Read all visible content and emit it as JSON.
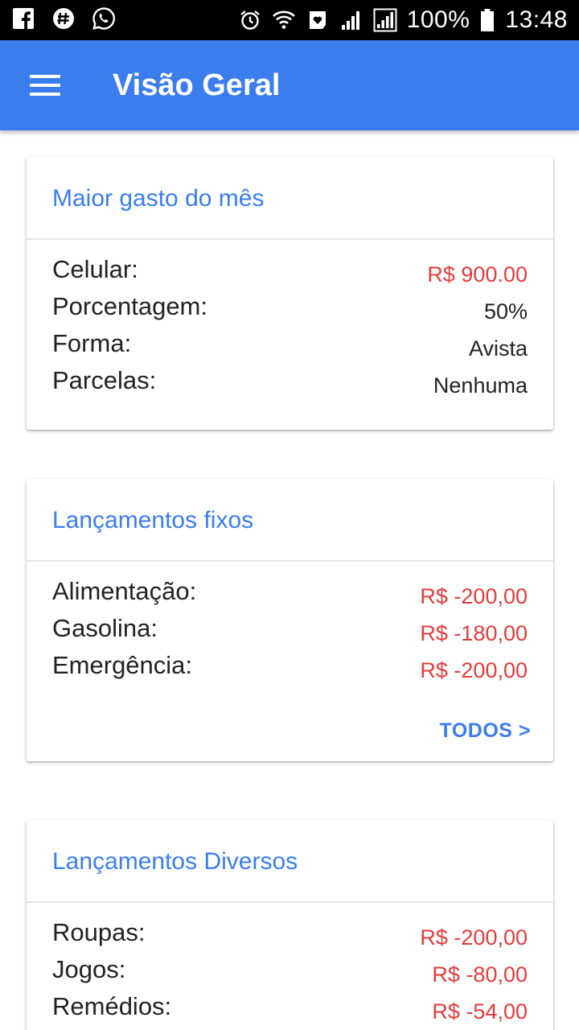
{
  "status_bar": {
    "left_icons": [
      "facebook-icon",
      "hashtag-app-icon",
      "whatsapp-icon"
    ],
    "right_icons": [
      "alarm-icon",
      "wifi-icon",
      "heart-notification-icon",
      "signal-icon",
      "signal-r-icon"
    ],
    "battery_text": "100%",
    "battery_icon": "battery-icon",
    "time": "13:48"
  },
  "app_bar": {
    "menu_icon": "hamburger-menu-icon",
    "title": "Visão Geral",
    "color": "#3b7ded"
  },
  "colors": {
    "accent": "#3b7ded",
    "negative": "#e63b3b",
    "text": "#222222"
  },
  "cards": [
    {
      "title": "Maior gasto do mês",
      "rows": [
        {
          "label": "Celular:",
          "value": "R$ 900.00",
          "highlight": true
        },
        {
          "label": "Porcentagem:",
          "value": "50%",
          "highlight": false
        },
        {
          "label": "Forma:",
          "value": "Avista",
          "highlight": false
        },
        {
          "label": "Parcelas:",
          "value": "Nenhuma",
          "highlight": false
        }
      ]
    },
    {
      "title": "Lançamentos fixos",
      "rows": [
        {
          "label": "Alimentação:",
          "value": "R$ -200,00",
          "highlight": true
        },
        {
          "label": "Gasolina:",
          "value": "R$ -180,00",
          "highlight": true
        },
        {
          "label": "Emergência:",
          "value": "R$ -200,00",
          "highlight": true
        }
      ],
      "link": "TODOS >"
    },
    {
      "title": "Lançamentos Diversos",
      "rows": [
        {
          "label": "Roupas:",
          "value": "R$ -200,00",
          "highlight": true
        },
        {
          "label": "Jogos:",
          "value": "R$ -80,00",
          "highlight": true
        },
        {
          "label": "Remédios:",
          "value": "R$ -54,00",
          "highlight": true
        }
      ]
    }
  ]
}
